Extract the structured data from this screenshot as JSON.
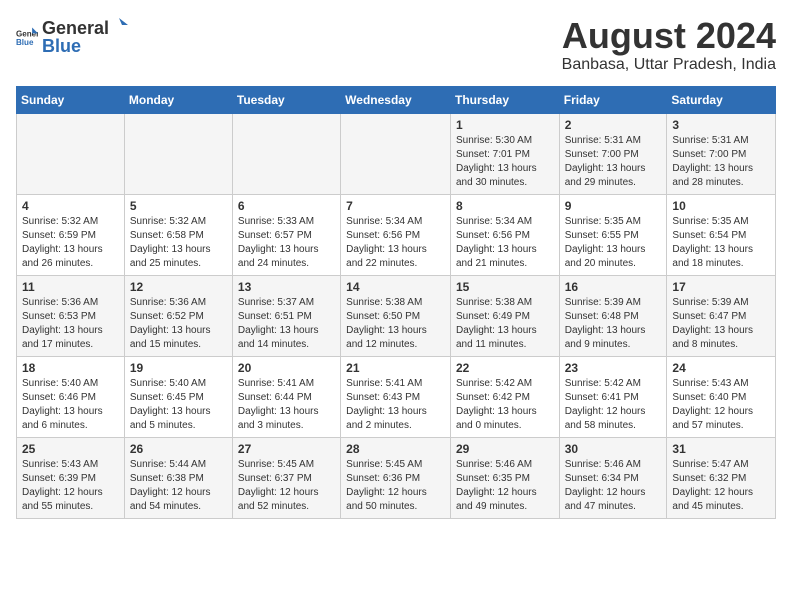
{
  "header": {
    "logo_general": "General",
    "logo_blue": "Blue",
    "month_year": "August 2024",
    "location": "Banbasa, Uttar Pradesh, India"
  },
  "calendar": {
    "days_of_week": [
      "Sunday",
      "Monday",
      "Tuesday",
      "Wednesday",
      "Thursday",
      "Friday",
      "Saturday"
    ],
    "weeks": [
      [
        {
          "day": "",
          "content": ""
        },
        {
          "day": "",
          "content": ""
        },
        {
          "day": "",
          "content": ""
        },
        {
          "day": "",
          "content": ""
        },
        {
          "day": "1",
          "content": "Sunrise: 5:30 AM\nSunset: 7:01 PM\nDaylight: 13 hours and 30 minutes."
        },
        {
          "day": "2",
          "content": "Sunrise: 5:31 AM\nSunset: 7:00 PM\nDaylight: 13 hours and 29 minutes."
        },
        {
          "day": "3",
          "content": "Sunrise: 5:31 AM\nSunset: 7:00 PM\nDaylight: 13 hours and 28 minutes."
        }
      ],
      [
        {
          "day": "4",
          "content": "Sunrise: 5:32 AM\nSunset: 6:59 PM\nDaylight: 13 hours and 26 minutes."
        },
        {
          "day": "5",
          "content": "Sunrise: 5:32 AM\nSunset: 6:58 PM\nDaylight: 13 hours and 25 minutes."
        },
        {
          "day": "6",
          "content": "Sunrise: 5:33 AM\nSunset: 6:57 PM\nDaylight: 13 hours and 24 minutes."
        },
        {
          "day": "7",
          "content": "Sunrise: 5:34 AM\nSunset: 6:56 PM\nDaylight: 13 hours and 22 minutes."
        },
        {
          "day": "8",
          "content": "Sunrise: 5:34 AM\nSunset: 6:56 PM\nDaylight: 13 hours and 21 minutes."
        },
        {
          "day": "9",
          "content": "Sunrise: 5:35 AM\nSunset: 6:55 PM\nDaylight: 13 hours and 20 minutes."
        },
        {
          "day": "10",
          "content": "Sunrise: 5:35 AM\nSunset: 6:54 PM\nDaylight: 13 hours and 18 minutes."
        }
      ],
      [
        {
          "day": "11",
          "content": "Sunrise: 5:36 AM\nSunset: 6:53 PM\nDaylight: 13 hours and 17 minutes."
        },
        {
          "day": "12",
          "content": "Sunrise: 5:36 AM\nSunset: 6:52 PM\nDaylight: 13 hours and 15 minutes."
        },
        {
          "day": "13",
          "content": "Sunrise: 5:37 AM\nSunset: 6:51 PM\nDaylight: 13 hours and 14 minutes."
        },
        {
          "day": "14",
          "content": "Sunrise: 5:38 AM\nSunset: 6:50 PM\nDaylight: 13 hours and 12 minutes."
        },
        {
          "day": "15",
          "content": "Sunrise: 5:38 AM\nSunset: 6:49 PM\nDaylight: 13 hours and 11 minutes."
        },
        {
          "day": "16",
          "content": "Sunrise: 5:39 AM\nSunset: 6:48 PM\nDaylight: 13 hours and 9 minutes."
        },
        {
          "day": "17",
          "content": "Sunrise: 5:39 AM\nSunset: 6:47 PM\nDaylight: 13 hours and 8 minutes."
        }
      ],
      [
        {
          "day": "18",
          "content": "Sunrise: 5:40 AM\nSunset: 6:46 PM\nDaylight: 13 hours and 6 minutes."
        },
        {
          "day": "19",
          "content": "Sunrise: 5:40 AM\nSunset: 6:45 PM\nDaylight: 13 hours and 5 minutes."
        },
        {
          "day": "20",
          "content": "Sunrise: 5:41 AM\nSunset: 6:44 PM\nDaylight: 13 hours and 3 minutes."
        },
        {
          "day": "21",
          "content": "Sunrise: 5:41 AM\nSunset: 6:43 PM\nDaylight: 13 hours and 2 minutes."
        },
        {
          "day": "22",
          "content": "Sunrise: 5:42 AM\nSunset: 6:42 PM\nDaylight: 13 hours and 0 minutes."
        },
        {
          "day": "23",
          "content": "Sunrise: 5:42 AM\nSunset: 6:41 PM\nDaylight: 12 hours and 58 minutes."
        },
        {
          "day": "24",
          "content": "Sunrise: 5:43 AM\nSunset: 6:40 PM\nDaylight: 12 hours and 57 minutes."
        }
      ],
      [
        {
          "day": "25",
          "content": "Sunrise: 5:43 AM\nSunset: 6:39 PM\nDaylight: 12 hours and 55 minutes."
        },
        {
          "day": "26",
          "content": "Sunrise: 5:44 AM\nSunset: 6:38 PM\nDaylight: 12 hours and 54 minutes."
        },
        {
          "day": "27",
          "content": "Sunrise: 5:45 AM\nSunset: 6:37 PM\nDaylight: 12 hours and 52 minutes."
        },
        {
          "day": "28",
          "content": "Sunrise: 5:45 AM\nSunset: 6:36 PM\nDaylight: 12 hours and 50 minutes."
        },
        {
          "day": "29",
          "content": "Sunrise: 5:46 AM\nSunset: 6:35 PM\nDaylight: 12 hours and 49 minutes."
        },
        {
          "day": "30",
          "content": "Sunrise: 5:46 AM\nSunset: 6:34 PM\nDaylight: 12 hours and 47 minutes."
        },
        {
          "day": "31",
          "content": "Sunrise: 5:47 AM\nSunset: 6:32 PM\nDaylight: 12 hours and 45 minutes."
        }
      ]
    ]
  }
}
